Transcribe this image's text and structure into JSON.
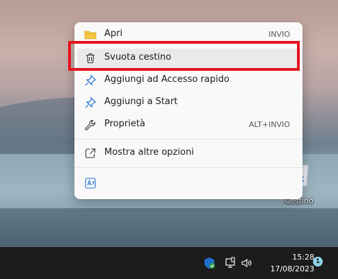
{
  "context_menu": {
    "items": [
      {
        "label": "Apri",
        "shortcut": "INVIO",
        "icon": "folder-icon"
      },
      {
        "label": "Svuota cestino",
        "shortcut": "",
        "icon": "trash-icon"
      },
      {
        "label": "Aggiungi ad Accesso rapido",
        "shortcut": "",
        "icon": "pin-icon"
      },
      {
        "label": "Aggiungi a Start",
        "shortcut": "",
        "icon": "pin-icon"
      },
      {
        "label": "Proprietà",
        "shortcut": "ALT+INVIO",
        "icon": "wrench-icon"
      },
      {
        "label": "Mostra altre opzioni",
        "shortcut": "",
        "icon": "open-external-icon"
      }
    ],
    "bottom_icons": [
      "translate-icon"
    ]
  },
  "desktop": {
    "recycle_bin_label": "Cestino"
  },
  "taskbar": {
    "time": "15:28",
    "date": "17/08/2023",
    "notification_count": "1",
    "tray_icons": [
      "security-shield-icon",
      "network-icon",
      "volume-icon"
    ]
  },
  "colors": {
    "highlight_border": "#e4131d",
    "taskbar_bg": "#1c1c1c",
    "menu_bg": "#f9f9f9",
    "pin_blue": "#1a6fd1",
    "folder_yellow": "#f4c542"
  }
}
